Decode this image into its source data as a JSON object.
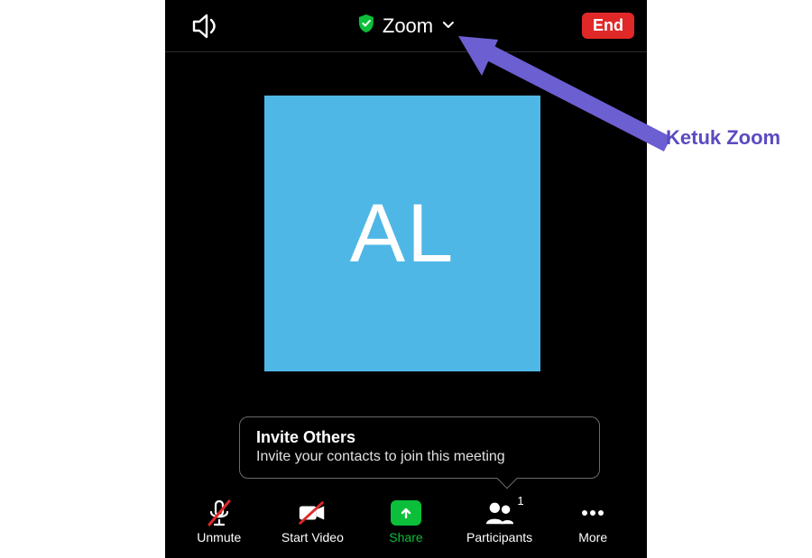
{
  "header": {
    "title": "Zoom",
    "end_label": "End"
  },
  "avatar": {
    "initials": "AL"
  },
  "tooltip": {
    "title": "Invite Others",
    "body": "Invite your contacts to join this meeting"
  },
  "toolbar": {
    "unmute": "Unmute",
    "start_video": "Start Video",
    "share": "Share",
    "participants": "Participants",
    "participants_count": "1",
    "more": "More"
  },
  "annotation": {
    "text": "Ketuk Zoom"
  },
  "colors": {
    "accent_green": "#0bbf3a",
    "end_red": "#e02828",
    "avatar_bg": "#4fb7e6",
    "annotation_purple": "#5a4bc2"
  }
}
